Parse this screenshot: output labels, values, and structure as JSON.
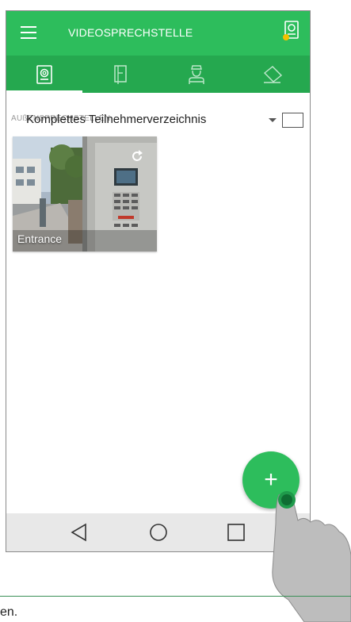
{
  "app": {
    "title": "VIDEOSPRECHSTELLE",
    "menu_icon": "hamburger-menu-icon",
    "station_icon": "door-station-icon",
    "accent_color": "#2dbd5c",
    "notification_dot_color": "#f4c000"
  },
  "tabs": [
    {
      "name": "door-stations",
      "icon": "video-door-station-icon",
      "active": true
    },
    {
      "name": "doors",
      "icon": "door-icon",
      "active": false
    },
    {
      "name": "concierge",
      "icon": "concierge-icon",
      "active": false
    },
    {
      "name": "cameras",
      "icon": "camera-icon",
      "active": false
    }
  ],
  "filter": {
    "caption": "AUßENSPRECHSTELLEN",
    "selected": "Komplettes Teilnehmerverzeichnis"
  },
  "stations": [
    {
      "label": "Entrance",
      "refresh_icon": "refresh-icon"
    }
  ],
  "fab": {
    "label": "+"
  },
  "navbar": {
    "back_icon": "back-triangle-icon",
    "home_icon": "home-circle-icon",
    "recents_icon": "recents-square-icon"
  },
  "footer": {
    "text": "en."
  }
}
